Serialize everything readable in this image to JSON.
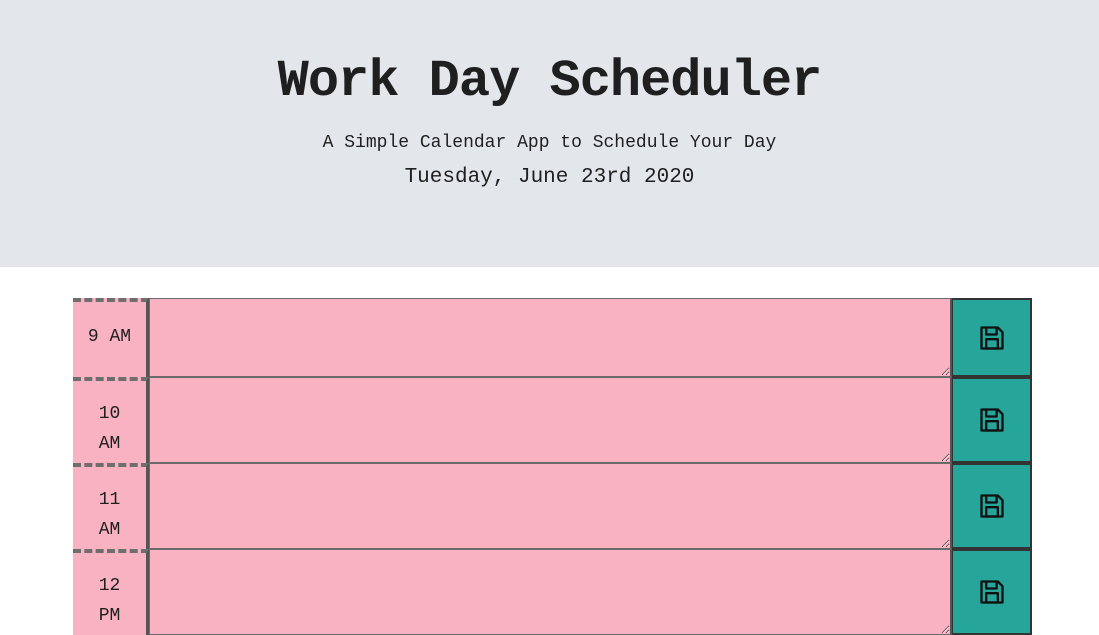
{
  "header": {
    "title": "Work Day Scheduler",
    "subtitle": "A Simple Calendar App to Schedule Your Day",
    "current_day": "Tuesday, June 23rd 2020"
  },
  "timeblocks": [
    {
      "hour_line1": "9 AM",
      "hour_line2": "",
      "text": "",
      "state": "future",
      "save_icon": "floppy-disk-icon"
    },
    {
      "hour_line1": "10",
      "hour_line2": "AM",
      "text": "",
      "state": "future",
      "save_icon": "floppy-disk-icon"
    },
    {
      "hour_line1": "11",
      "hour_line2": "AM",
      "text": "",
      "state": "future",
      "save_icon": "floppy-disk-icon"
    },
    {
      "hour_line1": "12",
      "hour_line2": "PM",
      "text": "",
      "state": "future",
      "save_icon": "floppy-disk-icon"
    }
  ],
  "colors": {
    "header_bg": "#e3e6ea",
    "future_bg": "#f8b2c1",
    "save_bg": "#26a69a"
  }
}
